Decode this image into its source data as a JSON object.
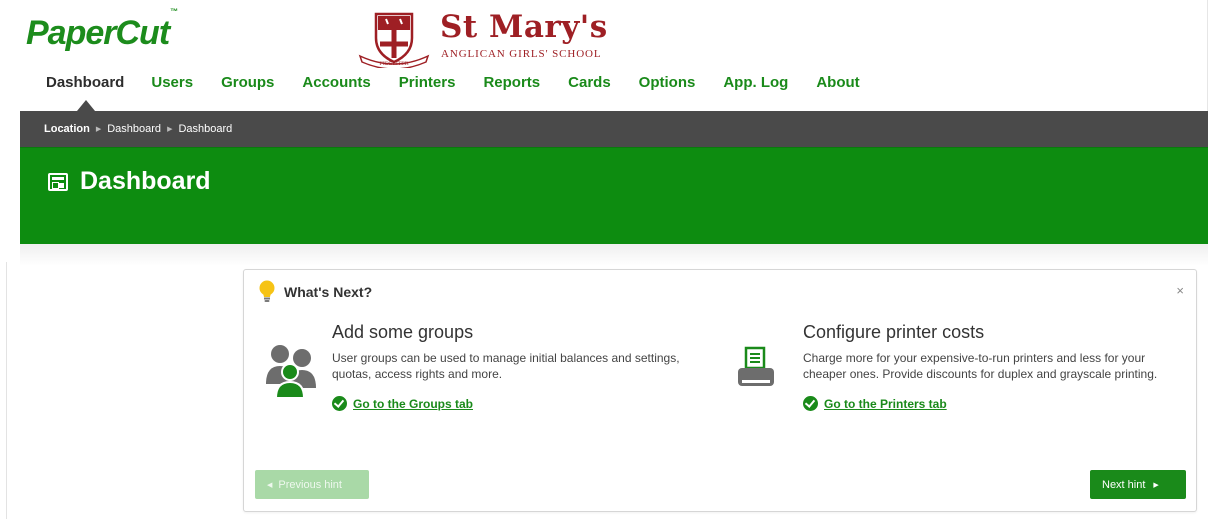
{
  "brand": {
    "app_name": "PaperCut",
    "tm": "™",
    "school_name": "St Mary's",
    "school_subtitle": "ANGLICAN GIRLS' SCHOOL",
    "school_motto": "FIDELITER",
    "accent_color": "#0d8c10",
    "school_color": "#9e1f24"
  },
  "nav": {
    "items": [
      {
        "label": "Dashboard",
        "active": true
      },
      {
        "label": "Users"
      },
      {
        "label": "Groups"
      },
      {
        "label": "Accounts"
      },
      {
        "label": "Printers"
      },
      {
        "label": "Reports"
      },
      {
        "label": "Cards"
      },
      {
        "label": "Options"
      },
      {
        "label": "App. Log"
      },
      {
        "label": "About"
      }
    ]
  },
  "breadcrumb": [
    "Location",
    "Dashboard",
    "Dashboard"
  ],
  "page": {
    "title": "Dashboard",
    "title_icon": "dashboard-icon"
  },
  "whats_next": {
    "title": "What's Next?",
    "close": "×",
    "icon": "lightbulb-icon",
    "hints": [
      {
        "title": "Add some groups",
        "body": "User groups can be used to manage initial balances and settings, quotas, access rights and more.",
        "link": "Go to the Groups tab",
        "icon": "groups-icon"
      },
      {
        "title": "Configure printer costs",
        "body": "Charge more for your expensive-to-run printers and less for your cheaper ones. Provide discounts for duplex and grayscale printing.",
        "link": "Go to the Printers tab",
        "icon": "printer-icon"
      }
    ],
    "prev_label": "Previous hint",
    "next_label": "Next hint"
  }
}
